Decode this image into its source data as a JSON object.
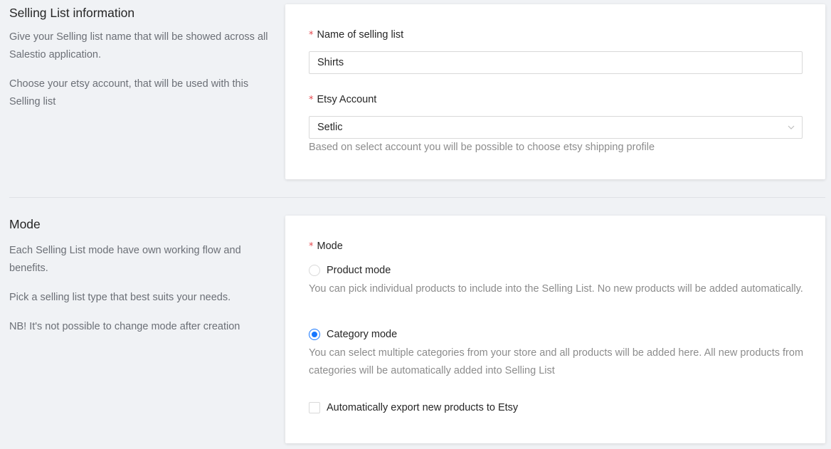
{
  "section_info": {
    "title": "Selling List information",
    "desc1": "Give your Selling list name that will be showed across all Salestio application.",
    "desc2": "Choose your etsy account, that will be used with this Selling list"
  },
  "form_info": {
    "name_label": "Name of selling list",
    "name_value": "Shirts",
    "account_label": "Etsy Account",
    "account_value": "Setlic",
    "account_help": "Based on select account you will be possible to choose etsy shipping profile",
    "required_mark": "*"
  },
  "section_mode": {
    "title": "Mode",
    "desc1": "Each Selling List mode have own working flow and benefits.",
    "desc2": "Pick a selling list type that best suits your needs.",
    "desc3": "NB! It's not possible to change mode after creation"
  },
  "form_mode": {
    "mode_label": "Mode",
    "required_mark": "*",
    "options": [
      {
        "label": "Product mode",
        "help": "You can pick individual products to include into the Selling List. No new products will be added automatically.",
        "checked": false
      },
      {
        "label": "Category mode",
        "help": "You can select multiple categories from your store and all products will be added here. All new products from categories will be automatically added into Selling List",
        "checked": true
      }
    ],
    "auto_export_label": "Automatically export new products to Etsy",
    "auto_export_checked": false
  },
  "colors": {
    "accent": "#1677ff",
    "required": "#e5484d",
    "background": "#f0f2f5"
  }
}
